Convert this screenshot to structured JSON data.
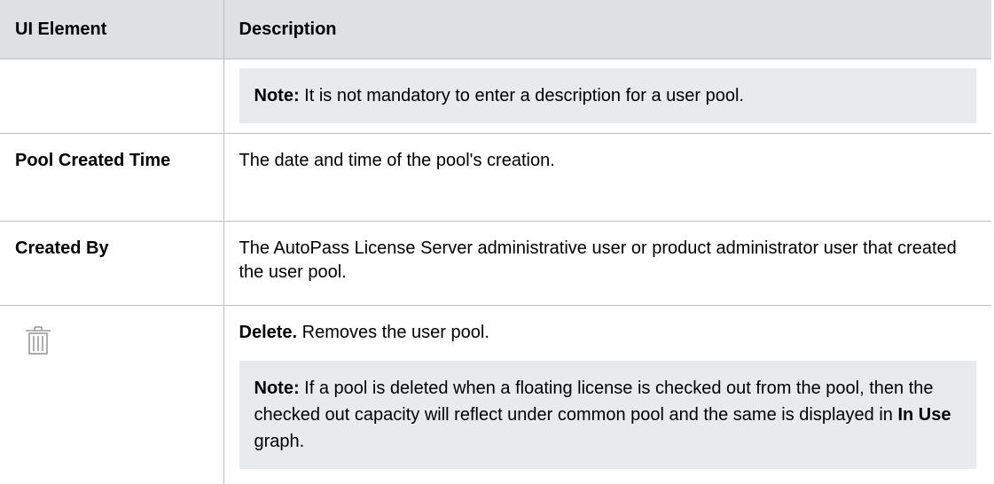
{
  "table": {
    "headers": {
      "element": "UI Element",
      "description": "Description"
    },
    "row_note_top": {
      "note_label": "Note:",
      "note_text": " It is not mandatory to enter a description for a user pool."
    },
    "row_pool_created_time": {
      "label": "Pool Created Time",
      "description": "The date and time of the pool's creation."
    },
    "row_created_by": {
      "label": "Created By",
      "description": "The AutoPass License Server administrative user or product administrator user that created the user pool."
    },
    "row_delete": {
      "icon": "trash-icon",
      "action_label": "Delete.",
      "action_text": " Removes the user pool.",
      "note_label": "Note:",
      "note_text_1": " If a pool is deleted when a floating license is checked out from the pool, then the checked out capacity will reflect under common pool and the same is displayed in ",
      "note_bold": "In Use",
      "note_text_2": " graph."
    }
  }
}
